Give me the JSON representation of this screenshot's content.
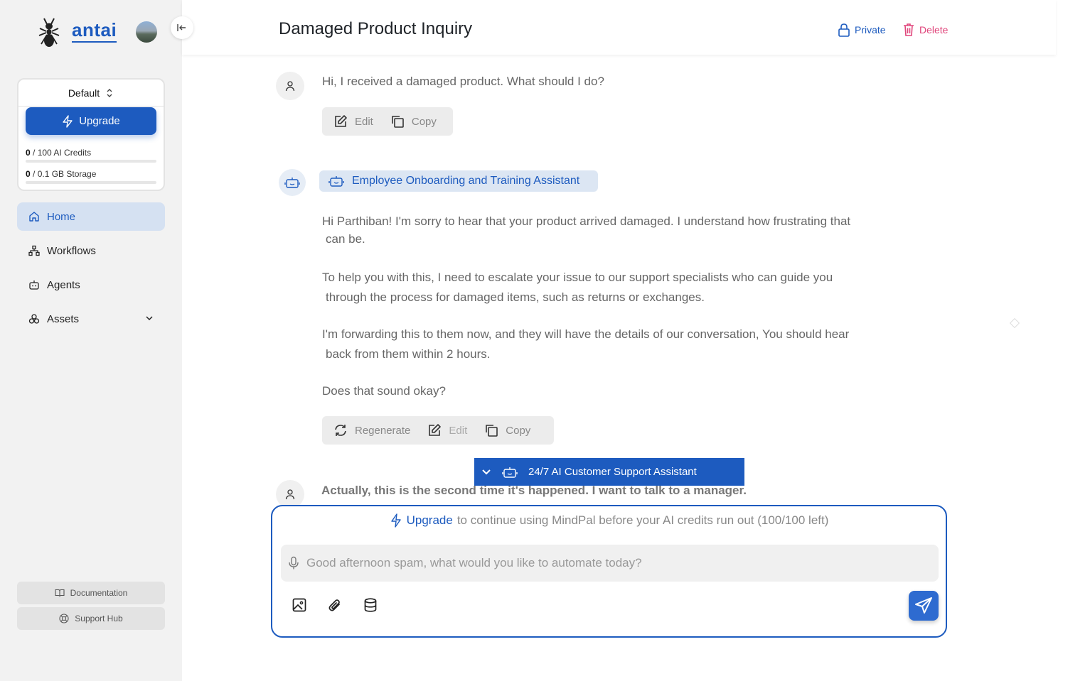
{
  "app": {
    "brand": "antai"
  },
  "sidebar": {
    "workspace": "Default",
    "upgrade_label": "Upgrade",
    "credits": {
      "used": "0",
      "rest": " / 100 AI Credits"
    },
    "storage": {
      "used": "0",
      "rest": " / 0.1 GB Storage"
    },
    "nav": [
      {
        "label": "Home",
        "icon": "home-icon",
        "active": true
      },
      {
        "label": "Workflows",
        "icon": "workflow-icon"
      },
      {
        "label": "Agents",
        "icon": "robot-icon"
      },
      {
        "label": "Assets",
        "icon": "assets-icon"
      }
    ],
    "footer": {
      "documentation": "Documentation",
      "support": "Support Hub"
    }
  },
  "header": {
    "title": "Damaged Product Inquiry",
    "private_label": "Private",
    "delete_label": "Delete"
  },
  "chat": {
    "user_message_1": "Hi, I received a damaged product. What should I do?",
    "user_actions": {
      "edit": "Edit",
      "copy": "Copy"
    },
    "agent_name": "Employee Onboarding and Training Assistant",
    "agent_reply": {
      "p1_line1": "Hi Parthiban! I'm sorry to hear that your product arrived damaged. I understand how frustrating that",
      "p1_line2": "can be.",
      "p2_line1": "To help you with this, I need to escalate your issue to our support specialists who can guide you",
      "p2_line2": "through the process for damaged items, such as returns or exchanges.",
      "p3_line1": "I'm forwarding this to them now, and they will have the details of our conversation, You should hear",
      "p3_line2": "back from them within 2 hours.",
      "p4": "Does that sound okay?"
    },
    "agent_actions": {
      "regenerate": "Regenerate",
      "edit": "Edit",
      "copy": "Copy"
    },
    "user_message_2": "Actually, this is the second time it's happened. I want to talk to a manager."
  },
  "agent_selector": {
    "label": "24/7 AI Customer Support Assistant"
  },
  "composer": {
    "upgrade_link": "Upgrade",
    "upgrade_text": "to continue using MindPal before your AI credits run out (100/100 left)",
    "placeholder": "Good afternoon spam, what would you like to automate today?"
  },
  "colors": {
    "accent": "#1d5bbf",
    "danger": "#e0457b"
  }
}
